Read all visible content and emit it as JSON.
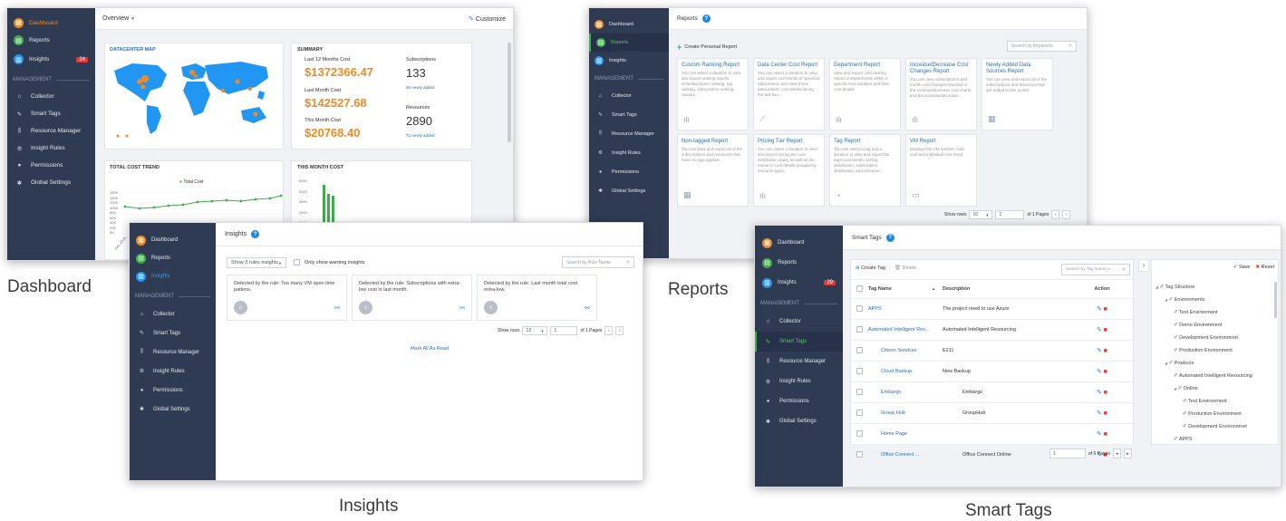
{
  "labels": {
    "dashboard": "Dashboard",
    "reports": "Reports",
    "insights": "Insights",
    "smart_tags": "Smart Tags"
  },
  "sidebar": {
    "dashboard": "Dashboard",
    "reports": "Reports",
    "insights": "Insights",
    "management": "MANAGEMENT",
    "collector": "Collector",
    "smart_tags": "Smart Tags",
    "resource_manager": "Resource Manager",
    "insight_rules": "Insight Rules",
    "permissions": "Permissions",
    "global_settings": "Global Settings",
    "insights_badge_dashboard": "24",
    "insights_badge_smarttags": "29"
  },
  "dashboard": {
    "overview": "Overview",
    "customize": "Customize",
    "map_title": "DATACENTER MAP",
    "summary_title": "SUMMARY",
    "last12_label": "Last 12 Months Cost",
    "last12_value": "$1372366.47",
    "lastmonth_label": "Last Month Cost",
    "lastmonth_value": "$142527.68",
    "thismonth_label": "This Month Cost",
    "thismonth_value": "$20768.40",
    "subs_label": "Subscriptions",
    "subs_value": "133",
    "subs_new": "85 newly added",
    "res_label": "Resources",
    "res_value": "2890",
    "res_new": "72 newly added",
    "trend_title": "TOTAL COST TREND",
    "trend_legend": "Total Cost",
    "trend_yticks": [
      "160K",
      "140K",
      "120K",
      "100K",
      "80K",
      "60K",
      "40K",
      "20K",
      "0K"
    ],
    "trend_xtick": "Dec 2018",
    "month_title": "THIS MONTH COST",
    "month_yticks": [
      "6000",
      "5000",
      "4000",
      "3000",
      "2000"
    ]
  },
  "reports": {
    "title": "Reports",
    "create": "Create Personal Report",
    "search_placeholder": "Search by Keywords",
    "tiles": [
      {
        "title": "Custom Ranking Report",
        "desc": "You can select a duration to view and export ranking reports including owner ranking, tag ranking, subscription ranking, resourc...",
        "icon": "bar-chart-icon"
      },
      {
        "title": "Data Center Cost Report",
        "desc": "You can select a duration to view and export cost trends of specified datacenters, and view these datacenters' cost details during the last two...",
        "icon": "line-chart-icon"
      },
      {
        "title": "Department Report",
        "desc": "View and export cost ranking report of departments within a specific time duration and their cost details.",
        "icon": "bar-chart-icon"
      },
      {
        "title": "Increase/Decrease Cost Changes Report",
        "desc": "You can view subscriptions' last month cost changes reported in the increase/decrease cost charts and the increase/decrease...",
        "icon": "bar-chart-icon"
      },
      {
        "title": "Newly Added Data Sources Report",
        "desc": "You can view and export all of the subscriptions and resources that are added in this month.",
        "icon": "table-icon"
      },
      {
        "title": "Non-tagged Report",
        "desc": "You can view and export all of the subscriptions and resources that have no tags applied.",
        "icon": "table-icon"
      },
      {
        "title": "Pricing Tier Report",
        "desc": "You can select a duration to view and export pricing tier cost distribution chart, as well as the resource cost details grouped by resource types.",
        "icon": "bar-chart-icon"
      },
      {
        "title": "Tag Report",
        "desc": "You can select a tag and a duration to view and export the tag's cost trends, sorting distribution, subscription distribution, and resource...",
        "icon": "pie-icon"
      },
      {
        "title": "VM Report",
        "desc": "Displays the VM number, total cost and individual cost trend.",
        "icon": "monitor-icon"
      }
    ],
    "show_rows": "Show rows",
    "rows_value": "10",
    "page_value": "1",
    "of_pages": "of 1 Pages"
  },
  "insights": {
    "title": "Insights",
    "filter": "Show 3 rules insights",
    "only_warning": "Only show warning insights",
    "search_placeholder": "Search by Rule Name",
    "cards": [
      {
        "text": "Detected by the rule: Too many VM open time pattens.",
        "count": "0"
      },
      {
        "text": "Detected by the rule: Subscriptions with extra-low cost in last month.",
        "count": "0"
      },
      {
        "text": "Detected by the rule: Last month total cost extra-low.",
        "count": "0"
      }
    ],
    "show_rows": "Show rows",
    "rows_value": "12",
    "page_value": "1",
    "of_pages": "of 1 Pages",
    "mark_all": "Mark All As Read"
  },
  "smart_tags": {
    "title": "Smart Tags",
    "create": "Create Tag",
    "delete": "Delete",
    "search_placeholder": "Search by Tag Name o...",
    "col_name": "Tag Name",
    "col_desc": "Description",
    "col_action": "Action",
    "rows": [
      {
        "name": "APPS",
        "desc": "The project need to use Azure"
      },
      {
        "name": "Automated Intelligent Res...",
        "desc": "Automated Intelligent Resourcing"
      },
      {
        "name": "Citizen Services",
        "desc": "E211"
      },
      {
        "name": "Cloud Backup",
        "desc": "New Backup"
      },
      {
        "name": "Embargo",
        "desc": "Embargo"
      },
      {
        "name": "Group Hub",
        "desc": "GroupHub"
      },
      {
        "name": "Home Page",
        "desc": ""
      },
      {
        "name": "Office Connect ...",
        "desc": "Office Connect Online"
      }
    ],
    "page_value": "1",
    "of_pages": "of 6 Pages",
    "save": "Save",
    "reset": "Reset",
    "tree": [
      {
        "label": "Tag Structure",
        "level": 0
      },
      {
        "label": "Environments",
        "level": 1
      },
      {
        "label": "Test Environment",
        "level": 2
      },
      {
        "label": "Demo Environment",
        "level": 2
      },
      {
        "label": "Development Environmnet",
        "level": 2
      },
      {
        "label": "Production Environment",
        "level": 2
      },
      {
        "label": "Products",
        "level": 1
      },
      {
        "label": "Automated Intelligent Resourcing",
        "level": 2
      },
      {
        "label": "Online",
        "level": 2
      },
      {
        "label": "Test Environment",
        "level": 3
      },
      {
        "label": "Production Environment",
        "level": 3
      },
      {
        "label": "Development Environmnet",
        "level": 3
      },
      {
        "label": "APPS",
        "level": 2
      }
    ]
  },
  "colors": {
    "sidebar": "#2f3b52",
    "accent_orange": "#f08a24",
    "link_blue": "#2d6fb7",
    "active_green": "#3fae49",
    "map_blue": "#2196f3",
    "danger": "#e53935"
  }
}
